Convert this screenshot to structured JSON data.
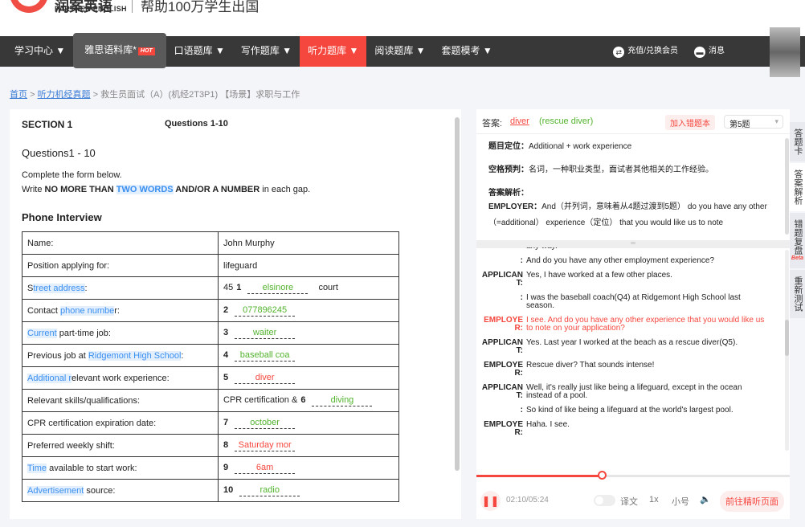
{
  "header": {
    "logo_cn": "润案英语",
    "logo_en": "PARTNER ENGLISH",
    "slogan": "帮助100万学生出国"
  },
  "nav": {
    "items": [
      "学习中心 ▼",
      "雅思语料库*",
      "口语题库 ▼",
      "写作题库 ▼",
      "听力题库 ▼",
      "阅读题库 ▼",
      "套题模考 ▼"
    ],
    "hot": "HOT",
    "recharge": "充值/兑换会员",
    "messages": "消息"
  },
  "breadcrumb": {
    "home": "首页",
    "section": "听力机经真题",
    "current": "> 救生员面试（A）(机经2T3P1) 【场景】求职与工作",
    "sep": ">"
  },
  "left": {
    "section": "SECTION 1",
    "questions": "Questions 1-10",
    "q_title": "Questions1 - 10",
    "inst1": "Complete the form below.",
    "inst2_a": "Write ",
    "inst2_b": "NO MORE THAN ",
    "inst2_c": "TWO WORDS",
    "inst2_d": " AND/OR A NUMBER",
    "inst2_e": " in each gap.",
    "form_title": "Phone Interview",
    "rows": [
      {
        "l": "Name:",
        "v": "John Murphy"
      },
      {
        "l": "Position applying for:",
        "v": "lifeguard"
      },
      {
        "l_pre": "S",
        "l_hl": "treet address",
        "l_post": ":",
        "pre": "45",
        "num": "1",
        "ans": "elsinore",
        "post": "court",
        "c": "g"
      },
      {
        "l_pre": "Contact ",
        "l_hl": "phone numbe",
        "l_post": "r:",
        "num": "2",
        "ans": "077896245",
        "c": "g"
      },
      {
        "l_pre": "",
        "l_hl": "Current",
        "l_post": " part-time job:",
        "num": "3",
        "ans": "waiter",
        "c": "g"
      },
      {
        "l_pre": "Previous job at ",
        "l_hl": "Ridgemont High School",
        "l_post": ":",
        "num": "4",
        "ans": "baseball coa",
        "c": "g"
      },
      {
        "l_pre": "",
        "l_hl": "Additional r",
        "l_post": "elevant work experience:",
        "num": "5",
        "ans": "diver",
        "c": "r"
      },
      {
        "l_pre": "Relevant skills/qualifications:",
        "l_hl": "",
        "l_post": "",
        "pre": "CPR certification &",
        "num": "6",
        "ans": "diving",
        "c": "g"
      },
      {
        "l_pre": "CPR certification expiration date:",
        "l_hl": "",
        "l_post": "",
        "num": "7",
        "ans": "october",
        "c": "g"
      },
      {
        "l_pre": "Preferred weekly shift:",
        "l_hl": "",
        "l_post": "",
        "num": "8",
        "ans": "Saturday mor",
        "c": "r"
      },
      {
        "l_pre": "",
        "l_hl": "Time",
        "l_post": " available to start work:",
        "num": "9",
        "ans": "6am",
        "c": "r"
      },
      {
        "l_pre": "",
        "l_hl": "Advertisement",
        "l_post": " source:",
        "num": "10",
        "ans": "radio",
        "c": "g"
      }
    ]
  },
  "answer": {
    "label": "答案:",
    "user": "diver",
    "correct": "(rescue diver)",
    "add_btn": "加入错题本",
    "question_select": "第5题",
    "loc_label": "题目定位：",
    "loc": "Additional + work experience",
    "pred_label": "空格预判：",
    "pred": "名词，一种职业类型，面试者其他相关的工作经验。",
    "ana_label": "答案解析：",
    "ana_spk": "EMPLOYER：",
    "ana_text": "And（并列词，意味着从4题过渡到5题） do you have any other（=additional） experience（定位） that you would like us to note"
  },
  "transcript": [
    {
      "s": "",
      "t": "any way."
    },
    {
      "s": ":",
      "t": "And do you have any other employment experience?"
    },
    {
      "s": "APPLICANT:",
      "t": "Yes, I have worked at a few other places."
    },
    {
      "s": ":",
      "t": "I was the baseball coach(Q4) at Ridgemont High School last season."
    },
    {
      "s": "EMPLOYER:",
      "t": "I see. And do you have any other experience that you would like us to note on your application?",
      "red": true
    },
    {
      "s": "APPLICANT:",
      "t": "Yes. Last year  I worked at the beach as a rescue diver(Q5)."
    },
    {
      "s": "EMPLOYER:",
      "t": "Rescue diver? That sounds intense!"
    },
    {
      "s": "APPLICANT:",
      "t": "Well, it's really just like being a lifeguard, except in the ocean instead of a pool."
    },
    {
      "s": ":",
      "t": "So kind of like being a lifeguard at the world's largest pool."
    },
    {
      "s": "EMPLOYER:",
      "t": "Haha. I see."
    }
  ],
  "player": {
    "time": "02:10/05:24",
    "progress": 0.4,
    "translate": "译文",
    "speed": "1x",
    "font_size": "小号",
    "goto": "前往精听页面"
  },
  "side_tabs": [
    "答题卡",
    "答案解析",
    "错题复盘",
    "重新测试"
  ],
  "beta": "Beta"
}
